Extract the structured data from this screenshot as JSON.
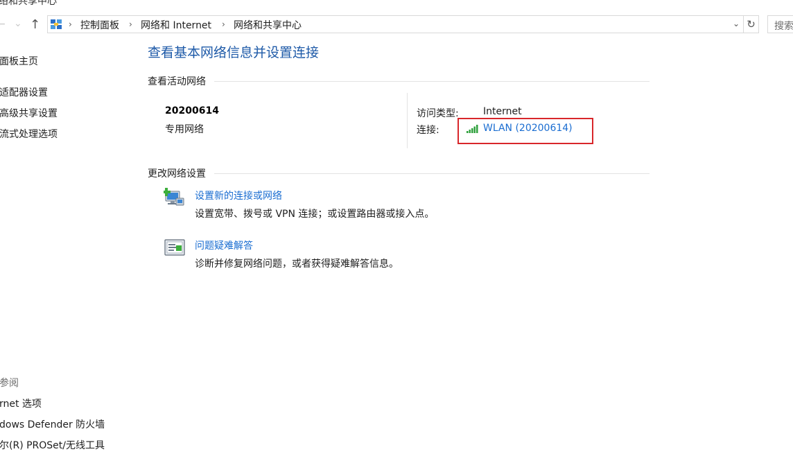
{
  "window": {
    "title_partial": "络和共享中心"
  },
  "nav": {
    "back_glyph": "←",
    "forward_glyph": "→",
    "up_glyph": "↑",
    "dropdown_glyph": "⌄",
    "refresh_glyph": "↻"
  },
  "address_bar": {
    "crumbs": [
      "控制面板",
      "网络和 Internet",
      "网络和共享中心"
    ],
    "separator": "›"
  },
  "search": {
    "placeholder": "搜索"
  },
  "sidebar": {
    "items": [
      {
        "label": "面板主页"
      },
      {
        "label": "适配器设置"
      },
      {
        "label": "高级共享设置"
      },
      {
        "label": "流式处理选项"
      }
    ],
    "see_also_heading": "参阅",
    "see_also": [
      {
        "label": "rnet 选项"
      },
      {
        "label": "dows Defender 防火墙"
      },
      {
        "label": "尔(R) PROSet/无线工具"
      }
    ]
  },
  "main": {
    "title": "查看基本网络信息并设置连接",
    "active_networks": {
      "heading": "查看活动网络",
      "network_name": "20200614",
      "network_type": "专用网络",
      "access_type_label": "访问类型:",
      "access_type_value": "Internet",
      "connection_label": "连接:",
      "connection_value": "WLAN (20200614)",
      "highlight_color": "#d8262a"
    },
    "change_settings": {
      "heading": "更改网络设置",
      "tasks": [
        {
          "icon": "new-connection-icon",
          "link": "设置新的连接或网络",
          "description": "设置宽带、拨号或 VPN 连接；或设置路由器或接入点。"
        },
        {
          "icon": "troubleshoot-icon",
          "link": "问题疑难解答",
          "description": "诊断并修复网络问题，或者获得疑难解答信息。"
        }
      ]
    }
  },
  "colors": {
    "link": "#1a6dd1",
    "title": "#1e5aa8",
    "signal": "#2fa03c"
  }
}
